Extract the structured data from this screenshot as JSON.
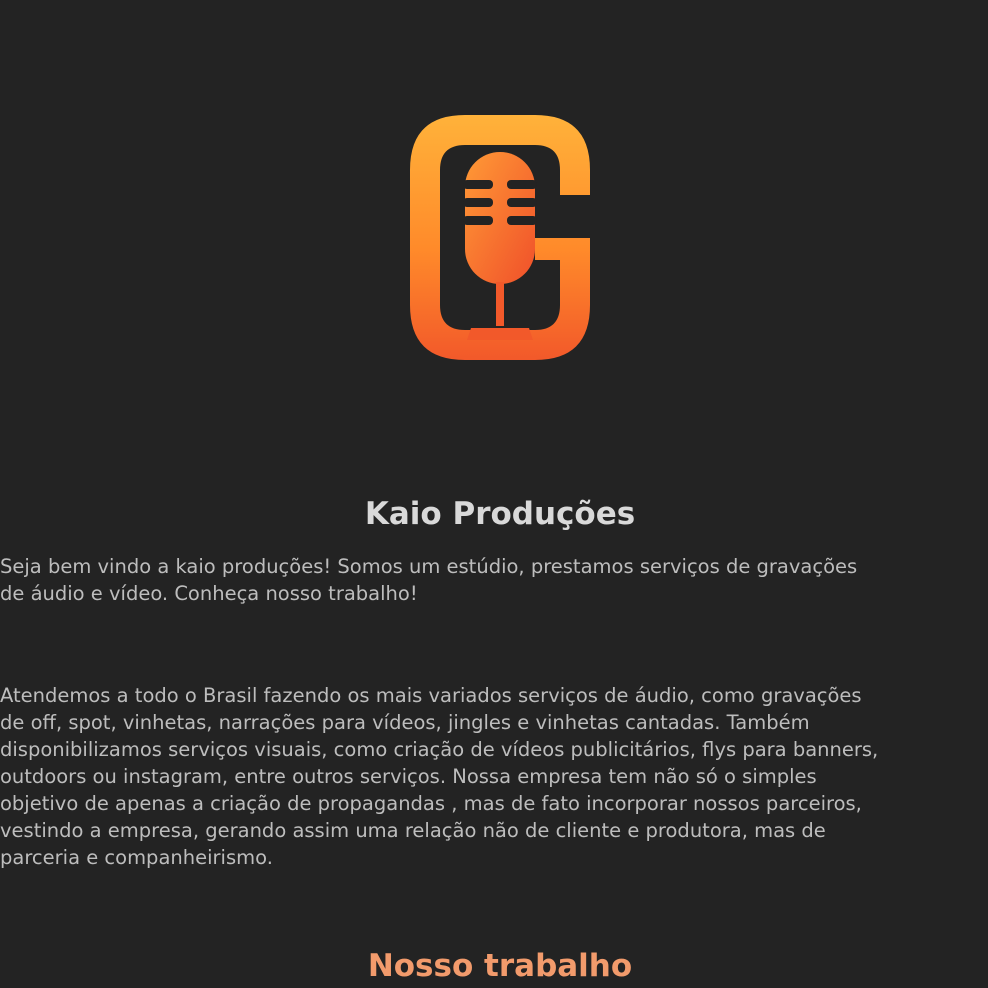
{
  "logo": {
    "icon": "microphone-g-logo",
    "colors": {
      "light": "#ffb23a",
      "dark": "#f2592a",
      "background": "#232323"
    }
  },
  "site_title": "Kaio Produções",
  "intro_lines": [
    "Seja bem vindo a kaio produções! Somos um estúdio, prestamos serviços de gravações",
    "de áudio e vídeo. Conheça nosso trabalho!"
  ],
  "about_lines": [
    "Atendemos a todo o Brasil fazendo os mais variados serviços de áudio, como gravações",
    "de off, spot, vinhetas, narrações para vídeos, jingles e vinhetas cantadas. Também",
    "disponibilizamos serviços visuais, como criação de vídeos publicitários, flys para banners,",
    "outdoors ou instagram, entre outros serviços. Nossa empresa tem não só o simples",
    "objetivo de apenas a criação de propagandas , mas de fato incorporar nossos parceiros,",
    "vestindo a empresa, gerando assim uma relação não de cliente e produtora, mas de",
    "parceria e companheirismo."
  ],
  "section_title": "Nosso trabalho",
  "colors": {
    "background": "#232323",
    "text": "#bdbdbd",
    "title": "#d9d9d9",
    "accent": "#f29b6c"
  }
}
